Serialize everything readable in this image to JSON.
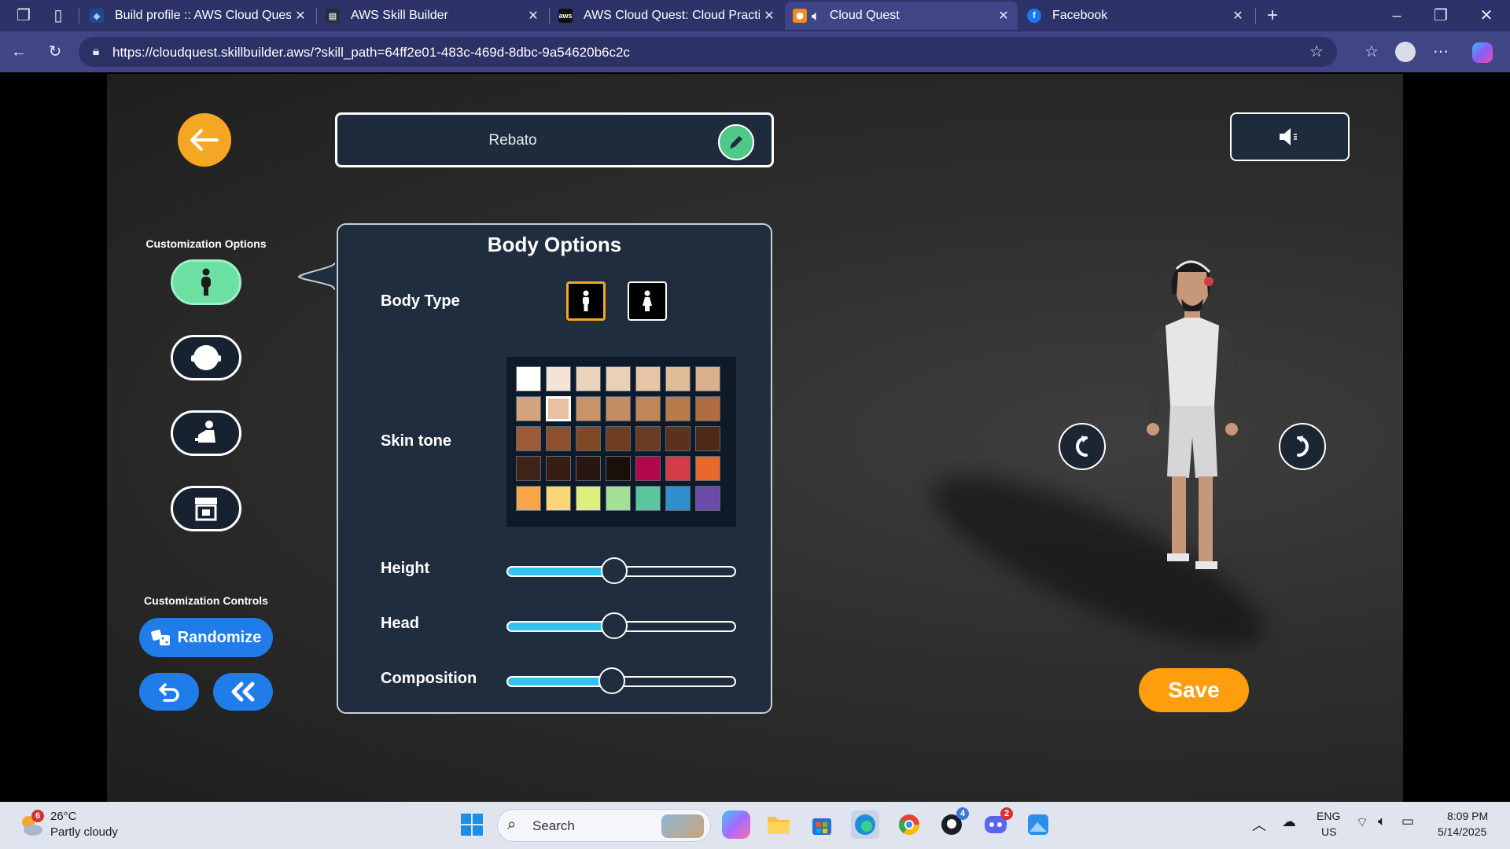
{
  "browser": {
    "tabs": [
      {
        "title": "Build profile :: AWS Cloud Quest: C",
        "icon": "aws-skill-icon"
      },
      {
        "title": "AWS Skill Builder",
        "icon": "aws-skill-builder-icon"
      },
      {
        "title": "AWS Cloud Quest: Cloud Practitio",
        "icon": "aws-icon"
      },
      {
        "title": "Cloud Quest",
        "icon": "cloud-quest-icon",
        "active": true
      },
      {
        "title": "Facebook",
        "icon": "facebook-icon"
      }
    ],
    "url": "https://cloudquest.skillbuilder.aws/?skill_path=64ff2e01-483c-469d-8dbc-9a54620b6c2c"
  },
  "game": {
    "player_name": "Rebato",
    "customization_options_label": "Customization Options",
    "customization_controls_label": "Customization Controls",
    "options": [
      {
        "name": "body",
        "icon": "body-icon",
        "selected": true
      },
      {
        "name": "head",
        "icon": "head-icon"
      },
      {
        "name": "outfit",
        "icon": "outfit-icon"
      },
      {
        "name": "store",
        "icon": "store-icon"
      }
    ],
    "panel": {
      "title": "Body Options",
      "body_type_label": "Body Type",
      "skin_tone_label": "Skin tone",
      "height_label": "Height",
      "head_label": "Head",
      "composition_label": "Composition"
    },
    "sliders": {
      "height": 0.47,
      "head": 0.47,
      "composition": 0.46
    },
    "skin_tones": [
      [
        "#ffffff",
        "#f3e4d6",
        "#ecd3bc",
        "#e9d0b7",
        "#e6c6a7",
        "#dfbb98",
        "#d9b08b"
      ],
      [
        "#d3a57e",
        "#e7c1a1",
        "#c99367",
        "#c48c62",
        "#c18658",
        "#b97b4c",
        "#b06e3f"
      ],
      [
        "#9c5b36",
        "#8e4f2d",
        "#814828",
        "#6e3d22",
        "#6a3a21",
        "#5b321d",
        "#4d2a18"
      ],
      [
        "#3f2318",
        "#361c13",
        "#2a1610",
        "#1b0f0b",
        "#b3064d",
        "#d23c47",
        "#e8692e"
      ],
      [
        "#f9a64a",
        "#f7d777",
        "#dcee7e",
        "#a3df97",
        "#5bc7a0",
        "#2f8fcb",
        "#6c4aa8"
      ]
    ],
    "selected_skin": [
      1,
      1
    ],
    "randomize_label": "Randomize",
    "save_label": "Save"
  },
  "taskbar": {
    "weather_temp": "26°C",
    "weather_desc": "Partly cloudy",
    "weather_badge": "6",
    "search_placeholder": "Search",
    "lang": "ENG",
    "region": "US",
    "time": "8:09 PM",
    "date": "5/14/2025",
    "github_badge": "4",
    "discord_badge": "2"
  }
}
